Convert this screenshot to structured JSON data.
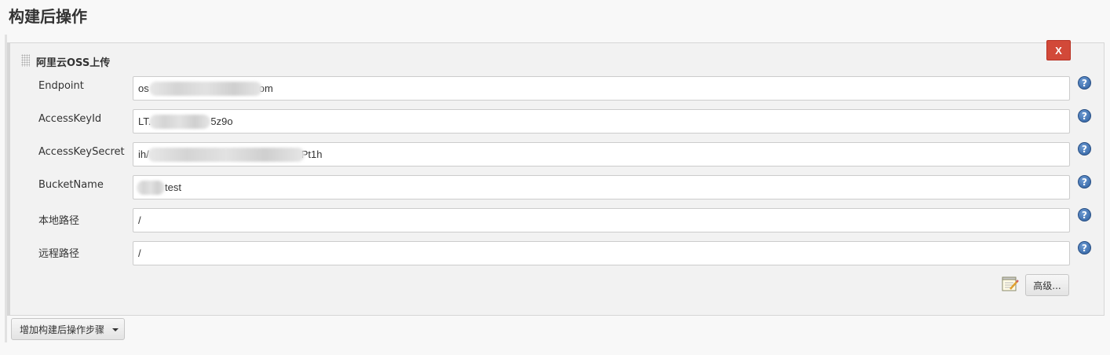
{
  "section": {
    "title": "构建后操作"
  },
  "panel": {
    "title": "阿里云OSS上传",
    "delete_label": "X",
    "fields": [
      {
        "label": "Endpoint",
        "value_prefix": "os",
        "value_suffix": "om"
      },
      {
        "label": "AccessKeyId",
        "value_prefix": "LT.",
        "value_suffix": "5z9o"
      },
      {
        "label": "AccessKeySecret",
        "value_prefix": "ih/",
        "value_suffix": "Pt1h"
      },
      {
        "label": "BucketName",
        "value_prefix": "",
        "value_suffix": "test"
      },
      {
        "label": "本地路径",
        "value_prefix": "/",
        "value_suffix": ""
      },
      {
        "label": "远程路径",
        "value_prefix": "/",
        "value_suffix": ""
      }
    ],
    "help_symbol": "?",
    "advanced_label": "高级..."
  },
  "add_step": {
    "label": "增加构建后操作步骤"
  },
  "colors": {
    "delete": "#d24939",
    "help": "#2e5f9f"
  }
}
